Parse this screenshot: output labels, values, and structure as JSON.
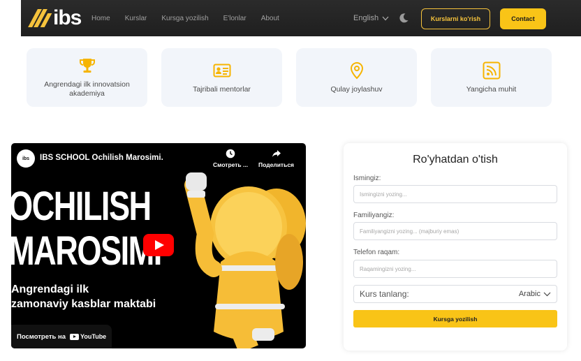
{
  "nav": {
    "logo_text": "ibs",
    "links": [
      "Home",
      "Kurslar",
      "Kursga yozilish",
      "E'lonlar",
      "About"
    ],
    "language": "English",
    "courses_button": "Kurslarni ko'rish",
    "contact_button": "Contact"
  },
  "features": [
    {
      "icon": "trophy-icon",
      "label": "Angrendagi ilk innovatsion akademiya"
    },
    {
      "icon": "id-card-icon",
      "label": "Tajribali mentorlar"
    },
    {
      "icon": "location-pin-icon",
      "label": "Qulay joylashuv"
    },
    {
      "icon": "rss-icon",
      "label": "Yangicha muhit"
    }
  ],
  "video": {
    "channel_logo": "ibs",
    "title": "IBS SCHOOL Ochilish Marosimi.",
    "watch_later": "Смотреть ...",
    "share": "Поделиться",
    "headline_1": "OCHILISH",
    "headline_2": "MAROSIMI",
    "subline_1": "Angrendagi ilk",
    "subline_2": "zamonaviy kasblar maktabi",
    "watch_on": "Посмотреть на",
    "youtube": "YouTube"
  },
  "form": {
    "title": "Ro'yhatdan o'tish",
    "name_label": "Ismingiz:",
    "name_placeholder": "Ismingizni yozing...",
    "surname_label": "Familiyangiz:",
    "surname_placeholder": "Familiyangizni yozing... (majburiy emas)",
    "phone_label": "Telefon raqam:",
    "phone_placeholder": "Raqamingizni yozing...",
    "course_label": "Kurs tanlang:",
    "course_value": "Arabic",
    "submit": "Kursga yozilish"
  },
  "colors": {
    "accent": "#f9c417",
    "nav_bg": "#232323",
    "card_bg": "#f2f5fa"
  }
}
